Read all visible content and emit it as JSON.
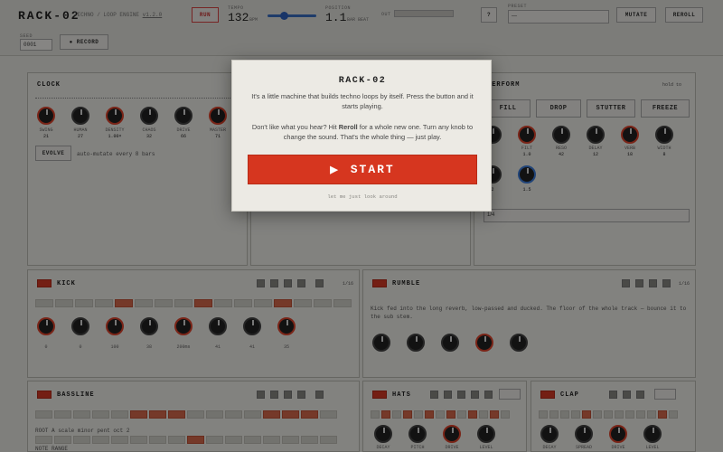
{
  "app": {
    "logo": "RACK-02"
  },
  "header": {
    "tagline": "TECHNO / LOOP ENGINE",
    "version": "v1.2.0",
    "run_label": "RUN",
    "tempo_label": "TEMPO",
    "tempo_value": "132",
    "tempo_unit": "BPM",
    "position_label": "POSITION",
    "position_value": "1.1",
    "position_unit": "BAR BEAT",
    "out_label": "OUT",
    "preset_label": "PRESET",
    "preset_value": "—",
    "mutate_label": "MUTATE",
    "reroll_label": "REROLL",
    "seed_label": "SEED",
    "seed_value": "0001",
    "record_label": "● RECORD"
  },
  "clock": {
    "title": "CLOCK",
    "knobs": [
      {
        "label": "SWING",
        "value": "21"
      },
      {
        "label": "HUMAN",
        "value": "27"
      },
      {
        "label": "DENSITY",
        "value": "1.00×"
      },
      {
        "label": "CHAOS",
        "value": "32"
      },
      {
        "label": "DRIVE",
        "value": "66"
      },
      {
        "label": "MASTER",
        "value": "71"
      }
    ],
    "evolve_label": "EVOLVE",
    "evolve_hint": "auto-mutate every 8 bars"
  },
  "perform": {
    "title": "PERFORM",
    "hint": "hold to",
    "buttons": [
      "FILL",
      "DROP",
      "STUTTER",
      "FREEZE"
    ],
    "knob_values": [
      "",
      "1.0",
      "42",
      "12",
      "18",
      "8",
      "2",
      "1.5"
    ],
    "knob_labels": [
      "",
      "FILT",
      "RESO",
      "DELAY",
      "VERB",
      "WIDTH",
      "",
      ""
    ],
    "select_value": "1/4"
  },
  "kick": {
    "title": "KICK",
    "steps_label": "1/16",
    "knob_values": [
      "0",
      "0",
      "100",
      "38",
      "200ms",
      "41",
      "41",
      "35"
    ]
  },
  "rumble": {
    "title": "RUMBLE",
    "steps_label": "1/16",
    "text": "Kick fed into the long reverb, low-passed and ducked. The floor of the whole track — bounce it to the sub stem."
  },
  "bassline": {
    "title": "BASSLINE",
    "sub": "ROOT  A  scale  minor  pent  oct  2",
    "sub2": "NOTE RANGE"
  },
  "hats": {
    "title": "HATS",
    "knob_labels": [
      "DECAY",
      "PITCH",
      "DRIVE",
      "LEVEL"
    ]
  },
  "clap": {
    "title": "CLAP",
    "knob_labels": [
      "DECAY",
      "SPREAD",
      "DRIVE",
      "LEVEL"
    ]
  },
  "modal": {
    "title": "RACK-02",
    "line1": "It's a little machine that builds techno loops by itself. Press the button and it starts playing.",
    "line2_a": "Don't like what you hear? Hit ",
    "line2_b": "Reroll",
    "line2_c": " for a whole new one. Turn any knob to change the sound. That's the whole thing — just play.",
    "start_icon": "▶",
    "start_label": "START",
    "skip_label": "let me just look around"
  },
  "colors": {
    "accent": "#d6361f",
    "blue": "#3b7ddd",
    "panel": "#f1f0eb"
  }
}
